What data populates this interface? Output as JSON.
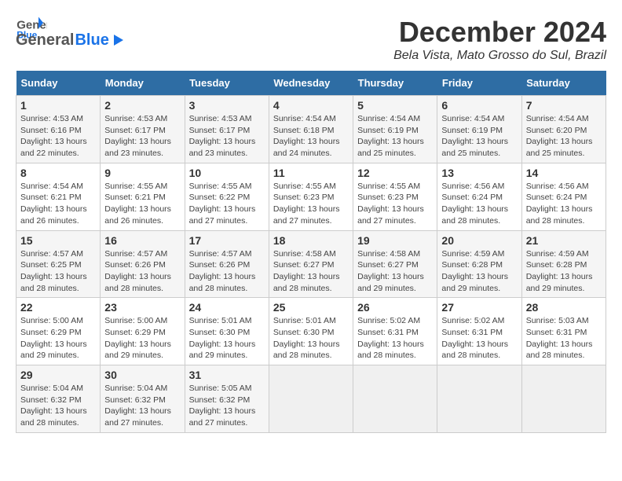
{
  "header": {
    "logo_general": "General",
    "logo_blue": "Blue",
    "title": "December 2024",
    "subtitle": "Bela Vista, Mato Grosso do Sul, Brazil"
  },
  "calendar": {
    "days_of_week": [
      "Sunday",
      "Monday",
      "Tuesday",
      "Wednesday",
      "Thursday",
      "Friday",
      "Saturday"
    ],
    "weeks": [
      [
        {
          "day": "1",
          "sunrise": "Sunrise: 4:53 AM",
          "sunset": "Sunset: 6:16 PM",
          "daylight": "Daylight: 13 hours and 22 minutes."
        },
        {
          "day": "2",
          "sunrise": "Sunrise: 4:53 AM",
          "sunset": "Sunset: 6:17 PM",
          "daylight": "Daylight: 13 hours and 23 minutes."
        },
        {
          "day": "3",
          "sunrise": "Sunrise: 4:53 AM",
          "sunset": "Sunset: 6:17 PM",
          "daylight": "Daylight: 13 hours and 23 minutes."
        },
        {
          "day": "4",
          "sunrise": "Sunrise: 4:54 AM",
          "sunset": "Sunset: 6:18 PM",
          "daylight": "Daylight: 13 hours and 24 minutes."
        },
        {
          "day": "5",
          "sunrise": "Sunrise: 4:54 AM",
          "sunset": "Sunset: 6:19 PM",
          "daylight": "Daylight: 13 hours and 25 minutes."
        },
        {
          "day": "6",
          "sunrise": "Sunrise: 4:54 AM",
          "sunset": "Sunset: 6:19 PM",
          "daylight": "Daylight: 13 hours and 25 minutes."
        },
        {
          "day": "7",
          "sunrise": "Sunrise: 4:54 AM",
          "sunset": "Sunset: 6:20 PM",
          "daylight": "Daylight: 13 hours and 25 minutes."
        }
      ],
      [
        {
          "day": "8",
          "sunrise": "Sunrise: 4:54 AM",
          "sunset": "Sunset: 6:21 PM",
          "daylight": "Daylight: 13 hours and 26 minutes."
        },
        {
          "day": "9",
          "sunrise": "Sunrise: 4:55 AM",
          "sunset": "Sunset: 6:21 PM",
          "daylight": "Daylight: 13 hours and 26 minutes."
        },
        {
          "day": "10",
          "sunrise": "Sunrise: 4:55 AM",
          "sunset": "Sunset: 6:22 PM",
          "daylight": "Daylight: 13 hours and 27 minutes."
        },
        {
          "day": "11",
          "sunrise": "Sunrise: 4:55 AM",
          "sunset": "Sunset: 6:23 PM",
          "daylight": "Daylight: 13 hours and 27 minutes."
        },
        {
          "day": "12",
          "sunrise": "Sunrise: 4:55 AM",
          "sunset": "Sunset: 6:23 PM",
          "daylight": "Daylight: 13 hours and 27 minutes."
        },
        {
          "day": "13",
          "sunrise": "Sunrise: 4:56 AM",
          "sunset": "Sunset: 6:24 PM",
          "daylight": "Daylight: 13 hours and 28 minutes."
        },
        {
          "day": "14",
          "sunrise": "Sunrise: 4:56 AM",
          "sunset": "Sunset: 6:24 PM",
          "daylight": "Daylight: 13 hours and 28 minutes."
        }
      ],
      [
        {
          "day": "15",
          "sunrise": "Sunrise: 4:57 AM",
          "sunset": "Sunset: 6:25 PM",
          "daylight": "Daylight: 13 hours and 28 minutes."
        },
        {
          "day": "16",
          "sunrise": "Sunrise: 4:57 AM",
          "sunset": "Sunset: 6:26 PM",
          "daylight": "Daylight: 13 hours and 28 minutes."
        },
        {
          "day": "17",
          "sunrise": "Sunrise: 4:57 AM",
          "sunset": "Sunset: 6:26 PM",
          "daylight": "Daylight: 13 hours and 28 minutes."
        },
        {
          "day": "18",
          "sunrise": "Sunrise: 4:58 AM",
          "sunset": "Sunset: 6:27 PM",
          "daylight": "Daylight: 13 hours and 28 minutes."
        },
        {
          "day": "19",
          "sunrise": "Sunrise: 4:58 AM",
          "sunset": "Sunset: 6:27 PM",
          "daylight": "Daylight: 13 hours and 29 minutes."
        },
        {
          "day": "20",
          "sunrise": "Sunrise: 4:59 AM",
          "sunset": "Sunset: 6:28 PM",
          "daylight": "Daylight: 13 hours and 29 minutes."
        },
        {
          "day": "21",
          "sunrise": "Sunrise: 4:59 AM",
          "sunset": "Sunset: 6:28 PM",
          "daylight": "Daylight: 13 hours and 29 minutes."
        }
      ],
      [
        {
          "day": "22",
          "sunrise": "Sunrise: 5:00 AM",
          "sunset": "Sunset: 6:29 PM",
          "daylight": "Daylight: 13 hours and 29 minutes."
        },
        {
          "day": "23",
          "sunrise": "Sunrise: 5:00 AM",
          "sunset": "Sunset: 6:29 PM",
          "daylight": "Daylight: 13 hours and 29 minutes."
        },
        {
          "day": "24",
          "sunrise": "Sunrise: 5:01 AM",
          "sunset": "Sunset: 6:30 PM",
          "daylight": "Daylight: 13 hours and 29 minutes."
        },
        {
          "day": "25",
          "sunrise": "Sunrise: 5:01 AM",
          "sunset": "Sunset: 6:30 PM",
          "daylight": "Daylight: 13 hours and 28 minutes."
        },
        {
          "day": "26",
          "sunrise": "Sunrise: 5:02 AM",
          "sunset": "Sunset: 6:31 PM",
          "daylight": "Daylight: 13 hours and 28 minutes."
        },
        {
          "day": "27",
          "sunrise": "Sunrise: 5:02 AM",
          "sunset": "Sunset: 6:31 PM",
          "daylight": "Daylight: 13 hours and 28 minutes."
        },
        {
          "day": "28",
          "sunrise": "Sunrise: 5:03 AM",
          "sunset": "Sunset: 6:31 PM",
          "daylight": "Daylight: 13 hours and 28 minutes."
        }
      ],
      [
        {
          "day": "29",
          "sunrise": "Sunrise: 5:04 AM",
          "sunset": "Sunset: 6:32 PM",
          "daylight": "Daylight: 13 hours and 28 minutes."
        },
        {
          "day": "30",
          "sunrise": "Sunrise: 5:04 AM",
          "sunset": "Sunset: 6:32 PM",
          "daylight": "Daylight: 13 hours and 27 minutes."
        },
        {
          "day": "31",
          "sunrise": "Sunrise: 5:05 AM",
          "sunset": "Sunset: 6:32 PM",
          "daylight": "Daylight: 13 hours and 27 minutes."
        },
        null,
        null,
        null,
        null
      ]
    ]
  }
}
